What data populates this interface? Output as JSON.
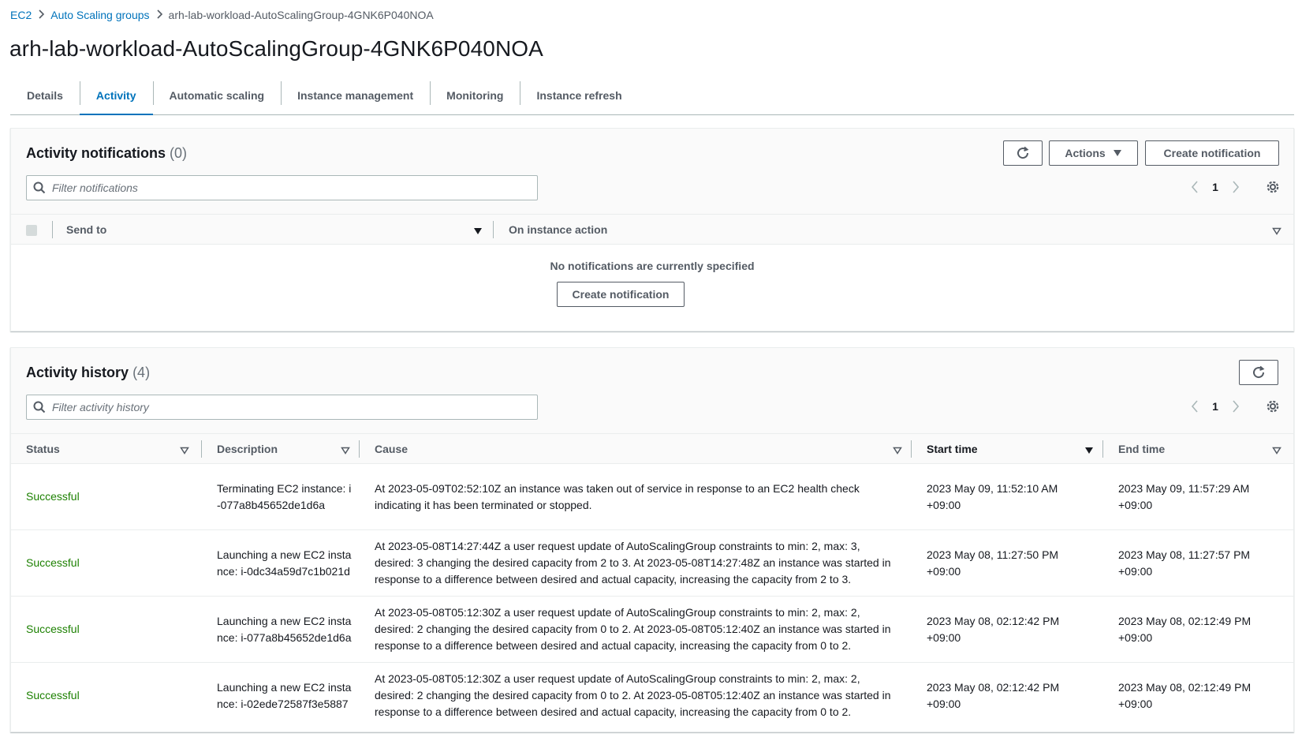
{
  "breadcrumb": {
    "items": [
      "EC2",
      "Auto Scaling groups"
    ],
    "current": "arh-lab-workload-AutoScalingGroup-4GNK6P040NOA"
  },
  "page": {
    "title": "arh-lab-workload-AutoScalingGroup-4GNK6P040NOA"
  },
  "tabs": [
    {
      "label": "Details",
      "active": false
    },
    {
      "label": "Activity",
      "active": true
    },
    {
      "label": "Automatic scaling",
      "active": false
    },
    {
      "label": "Instance management",
      "active": false
    },
    {
      "label": "Monitoring",
      "active": false
    },
    {
      "label": "Instance refresh",
      "active": false
    }
  ],
  "notifications": {
    "title": "Activity notifications",
    "count": "(0)",
    "actions_label": "Actions",
    "create_label": "Create notification",
    "filter_placeholder": "Filter notifications",
    "page": "1",
    "columns": [
      "Send to",
      "On instance action"
    ],
    "empty_message": "No notifications are currently specified",
    "empty_create_label": "Create notification"
  },
  "history": {
    "title": "Activity history",
    "count": "(4)",
    "filter_placeholder": "Filter activity history",
    "page": "1",
    "columns": [
      "Status",
      "Description",
      "Cause",
      "Start time",
      "End time"
    ],
    "rows": [
      {
        "status": "Successful",
        "description": "Terminating EC2 instance: i-077a8b45652de1d6a",
        "cause": "At 2023-05-09T02:52:10Z an instance was taken out of service in response to an EC2 health check indicating it has been terminated or stopped.",
        "start": "2023 May 09, 11:52:10 AM +09:00",
        "end": "2023 May 09, 11:57:29 AM +09:00"
      },
      {
        "status": "Successful",
        "description": "Launching a new EC2 instance: i-0dc34a59d7c1b021d",
        "cause": "At 2023-05-08T14:27:44Z a user request update of AutoScalingGroup constraints to min: 2, max: 3, desired: 3 changing the desired capacity from 2 to 3. At 2023-05-08T14:27:48Z an instance was started in response to a difference between desired and actual capacity, increasing the capacity from 2 to 3.",
        "start": "2023 May 08, 11:27:50 PM +09:00",
        "end": "2023 May 08, 11:27:57 PM +09:00"
      },
      {
        "status": "Successful",
        "description": "Launching a new EC2 instance: i-077a8b45652de1d6a",
        "cause": "At 2023-05-08T05:12:30Z a user request update of AutoScalingGroup constraints to min: 2, max: 2, desired: 2 changing the desired capacity from 0 to 2. At 2023-05-08T05:12:40Z an instance was started in response to a difference between desired and actual capacity, increasing the capacity from 0 to 2.",
        "start": "2023 May 08, 02:12:42 PM +09:00",
        "end": "2023 May 08, 02:12:49 PM +09:00"
      },
      {
        "status": "Successful",
        "description": "Launching a new EC2 instance: i-02ede72587f3e5887",
        "cause": "At 2023-05-08T05:12:30Z a user request update of AutoScalingGroup constraints to min: 2, max: 2, desired: 2 changing the desired capacity from 0 to 2. At 2023-05-08T05:12:40Z an instance was started in response to a difference between desired and actual capacity, increasing the capacity from 0 to 2.",
        "start": "2023 May 08, 02:12:42 PM +09:00",
        "end": "2023 May 08, 02:12:49 PM +09:00"
      }
    ]
  },
  "colors": {
    "link": "#0073bb",
    "success": "#1d8102",
    "text": "#16191f",
    "muted": "#545b64"
  }
}
